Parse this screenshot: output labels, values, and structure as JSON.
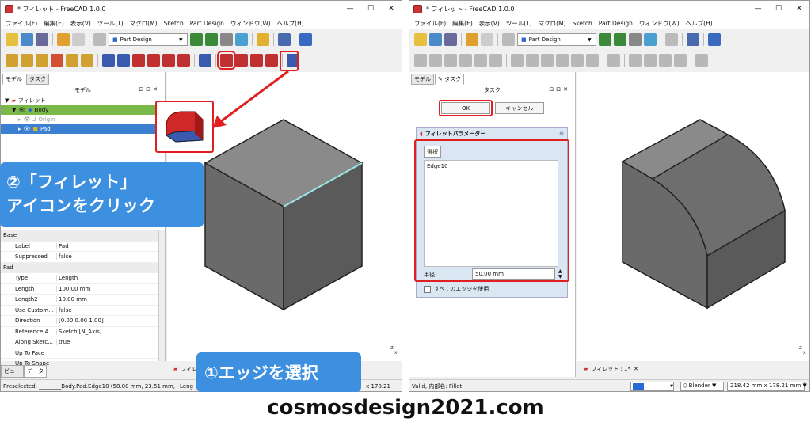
{
  "left": {
    "title": "* フィレット - FreeCAD 1.0.0",
    "menu": [
      "ファイル(F)",
      "編集(E)",
      "表示(V)",
      "ツール(T)",
      "マクロ(M)",
      "Sketch",
      "Part Design",
      "ウィンドウ(W)",
      "ヘルプ(H)"
    ],
    "workbench": "Part Design",
    "tabs": {
      "model": "モデル",
      "task": "タスク"
    },
    "panel_title": "モデル",
    "tree": {
      "root": "フィレット",
      "body": "Body",
      "origin": "Origin",
      "pad": "Pad"
    },
    "props": [
      {
        "k": "Base",
        "v": "",
        "group": true
      },
      {
        "k": "Label",
        "v": "Pad"
      },
      {
        "k": "Suppressed",
        "v": "false"
      },
      {
        "k": "Pad",
        "v": "",
        "group": true
      },
      {
        "k": "Type",
        "v": "Length"
      },
      {
        "k": "Length",
        "v": "100.00 mm"
      },
      {
        "k": "Length2",
        "v": "10.00 mm"
      },
      {
        "k": "Use Custom...",
        "v": "false"
      },
      {
        "k": "Direction",
        "v": "[0.00 0.00 1.00]"
      },
      {
        "k": "Reference A...",
        "v": "Sketch [N_Axis]"
      },
      {
        "k": "Along Sketc...",
        "v": "true"
      },
      {
        "k": "Up To Face",
        "v": ""
      },
      {
        "k": "Up To Shape",
        "v": ""
      }
    ],
    "bottom_tabs": {
      "view": "ビュー",
      "data": "データ"
    },
    "doc_tab": "フィレ",
    "status": "Preselected: ________Body.Pad.Edge10 (58.00 mm, 23.51 mm,",
    "status_trunc": "Leng",
    "status_dim": "x 178.21",
    "callout_fillet": "②「フィレット」アイコンをクリック",
    "callout_fillet_line1": "②「フィレット」",
    "callout_fillet_line2": "アイコンをクリック",
    "callout_edge": "①エッジを選択"
  },
  "right": {
    "title": "* フィレット - FreeCAD 1.0.0",
    "menu": [
      "ファイル(F)",
      "編集(E)",
      "表示(V)",
      "ツール(T)",
      "マクロ(M)",
      "Sketch",
      "Part Design",
      "ウィンドウ(W)",
      "ヘルプ(H)"
    ],
    "workbench": "Part Design",
    "tabs": {
      "model": "モデル",
      "task": "タスク"
    },
    "task_title": "タスク",
    "ok": "OK",
    "cancel": "キャンセル",
    "fillet_params": "フィレットパラメーター",
    "select": "選択",
    "edge": "Edge10",
    "radius_label": "半径:",
    "radius_value": "50.00 mm",
    "use_all_edges": "すべてのエッジを使用",
    "doc_tab": "フィレット : 1*",
    "status": "Valid, 内部名: Fillet",
    "nav": "Blender",
    "dims": "218.42 mm x 178.21 mm"
  },
  "footer": "cosmosdesign2021.com",
  "colors": {
    "accent_red": "#e02020",
    "callout_blue": "#3d8fe0",
    "body_green": "#7ab84a",
    "selection_blue": "#3b7fd1"
  }
}
